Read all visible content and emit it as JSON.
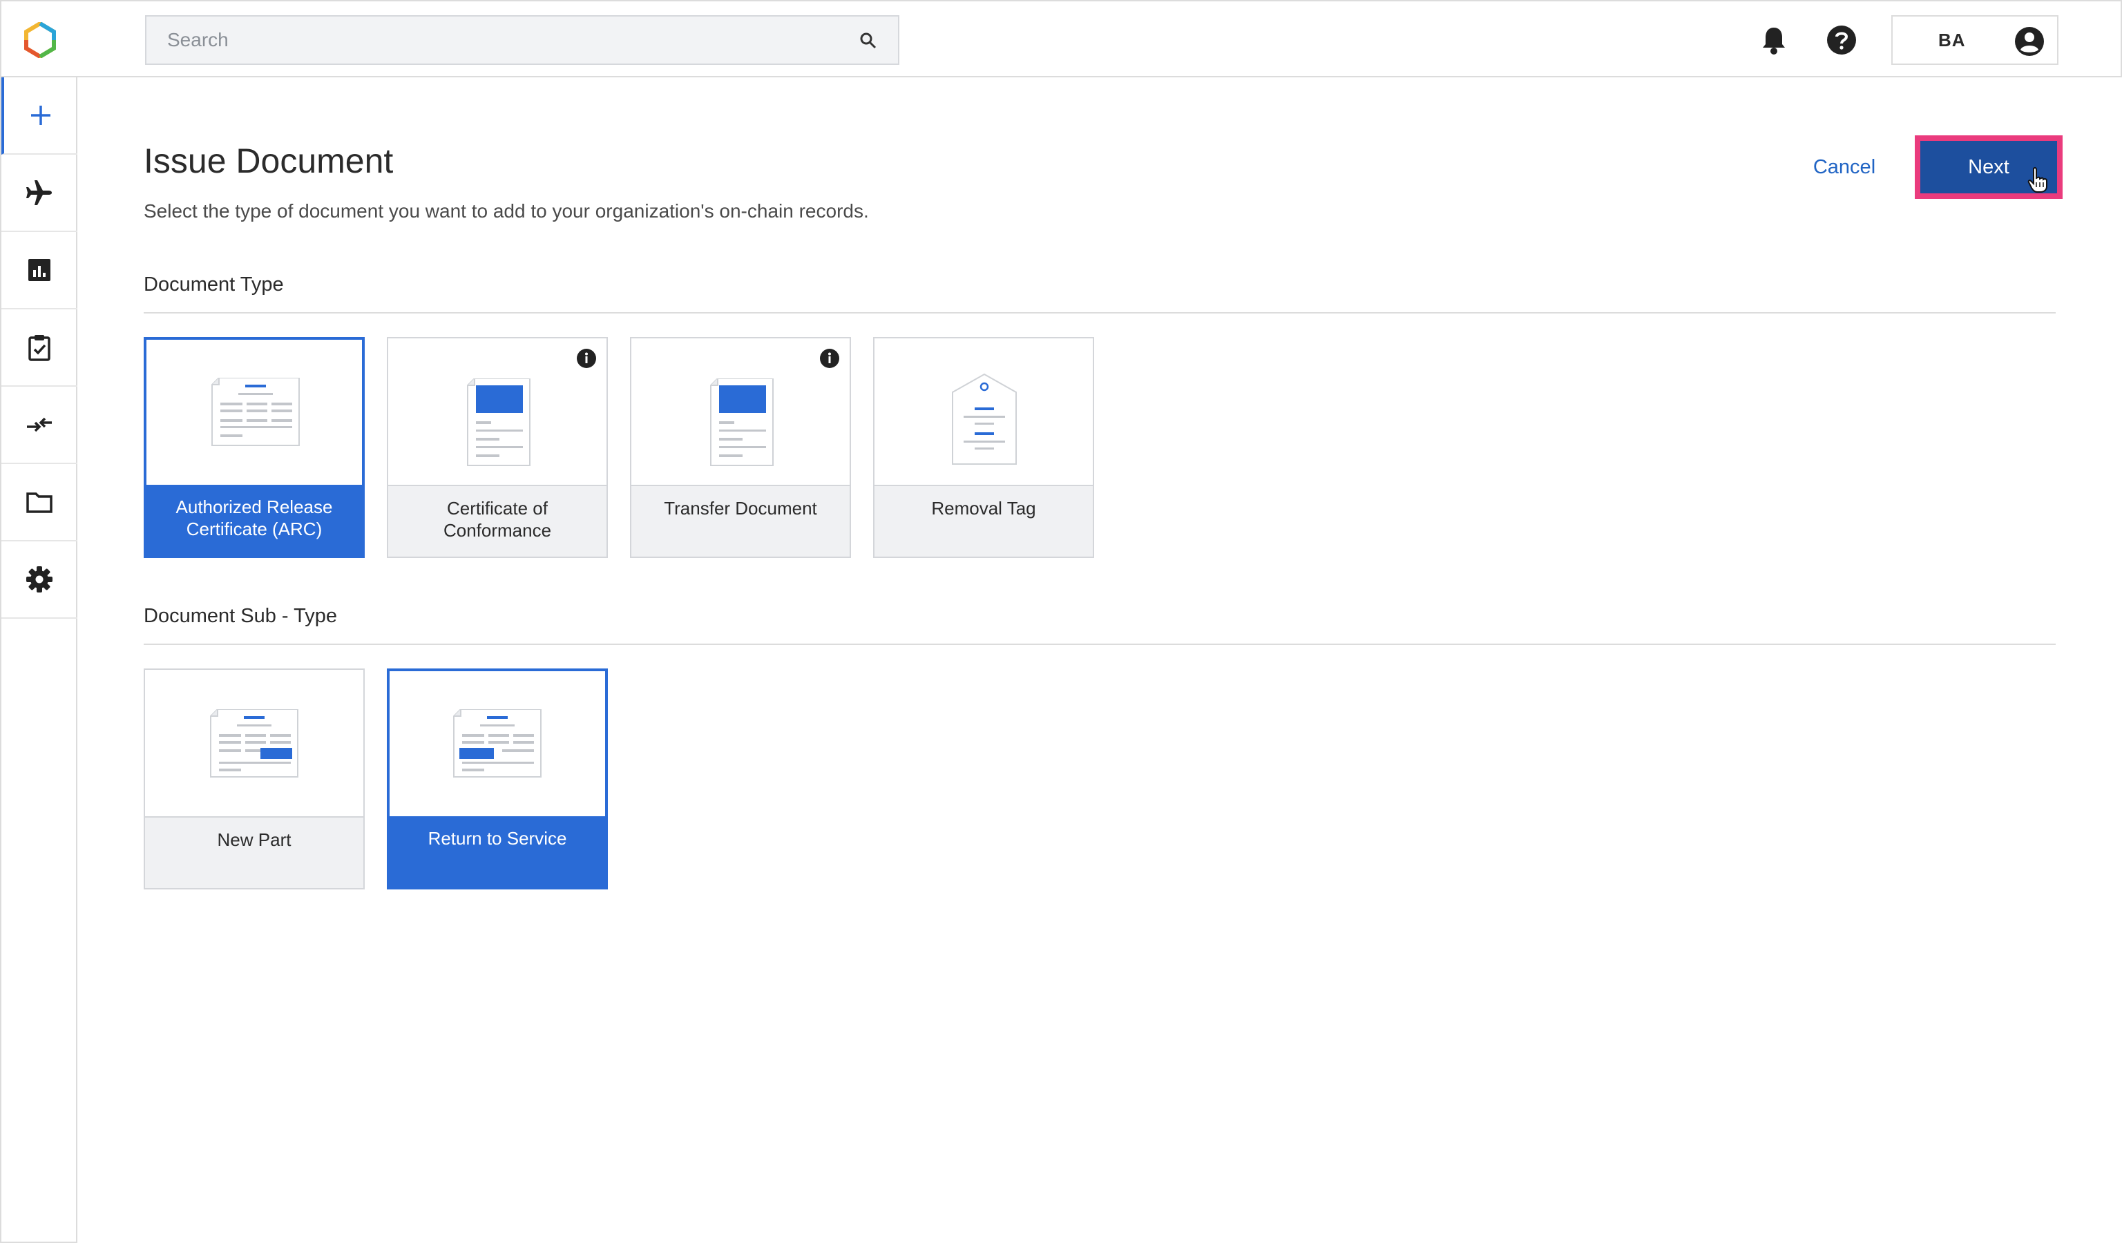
{
  "header": {
    "search_placeholder": "Search",
    "user_initials": "BA",
    "icons": [
      "logo-icon",
      "search-icon",
      "bell-icon",
      "help-icon",
      "account-icon"
    ]
  },
  "sidebar": {
    "items": [
      {
        "name": "add-icon",
        "active": true
      },
      {
        "name": "airplane-icon",
        "active": false
      },
      {
        "name": "bar-chart-icon",
        "active": false
      },
      {
        "name": "clipboard-check-icon",
        "active": false
      },
      {
        "name": "transfer-arrows-icon",
        "active": false
      },
      {
        "name": "folder-icon",
        "active": false
      },
      {
        "name": "gear-icon",
        "active": false
      }
    ]
  },
  "main": {
    "title": "Issue Document",
    "subtitle": "Select the type of document you want to add to your organization's on-chain records.",
    "cancel_label": "Cancel",
    "next_label": "Next",
    "document_type": {
      "title": "Document Type",
      "cards": [
        {
          "label": "Authorized Release Certificate (ARC)",
          "selected": true,
          "info": false
        },
        {
          "label": "Certificate of Conformance",
          "selected": false,
          "info": true
        },
        {
          "label": "Transfer Document",
          "selected": false,
          "info": true
        },
        {
          "label": "Removal Tag",
          "selected": false,
          "info": false
        }
      ]
    },
    "document_sub_type": {
      "title": "Document Sub - Type",
      "cards": [
        {
          "label": "New Part",
          "selected": false
        },
        {
          "label": "Return to Service",
          "selected": true
        }
      ]
    }
  },
  "colors": {
    "accent": "#2a6bd6",
    "next_button": "#1d4f9e",
    "highlight": "#ea3b7d",
    "link": "#2064c4"
  }
}
